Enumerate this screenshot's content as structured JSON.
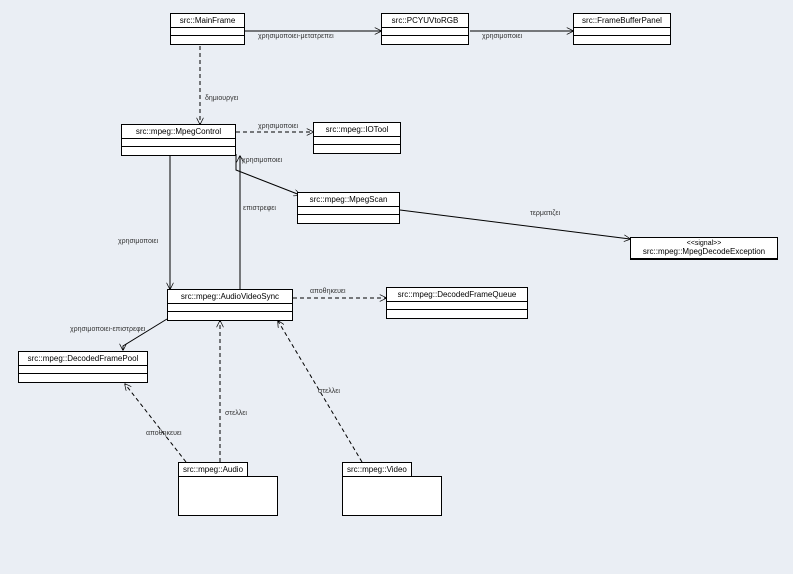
{
  "classes": {
    "MainFrame": "src::MainFrame",
    "PCYUVtoRGB": "src::PCYUVtoRGB",
    "FrameBufferPanel": "src::FrameBufferPanel",
    "MpegControl": "src::mpeg::MpegControl",
    "IOTool": "src::mpeg::IOTool",
    "MpegScan": "src::mpeg::MpegScan",
    "AudioVideoSync": "src::mpeg::AudioVideoSync",
    "DecodedFrameQueue": "src::mpeg::DecodedFrameQueue",
    "DecodedFramePool": "src::mpeg::DecodedFramePool",
    "MpegDecodeException": {
      "stereotype": "<<signal>>",
      "name": "src::mpeg::MpegDecodeException"
    }
  },
  "packages": {
    "Audio": "src::mpeg::Audio",
    "Video": "src::mpeg::Video"
  },
  "edges": {
    "MainFrame_PCYUVtoRGB": "χρησιμοποιει-μετατρεπει",
    "PCYUVtoRGB_FrameBufferPanel": "χρησιμοποιει",
    "MainFrame_MpegControl": "δημιουργει",
    "MpegControl_IOTool": "χρησιμοποιει",
    "MpegControl_MpegScan": "χρησιμοποιει",
    "MpegScan_MpegControl": "επιστρεφει",
    "MpegControl_AudioVideoSync": "χρησιμοποιει",
    "AudioVideoSync_DecodedFrameQueue": "αποθηκευει",
    "AudioVideoSync_DecodedFramePool": "χρησιμοποιει-επιστρεφει",
    "Audio_AudioVideoSync": "στελλει",
    "Audio_DecodedFramePool": "αποθηκευει",
    "Video_AudioVideoSync": "στελλει",
    "MpegScan_MpegDecodeException": "τερματιζει"
  }
}
